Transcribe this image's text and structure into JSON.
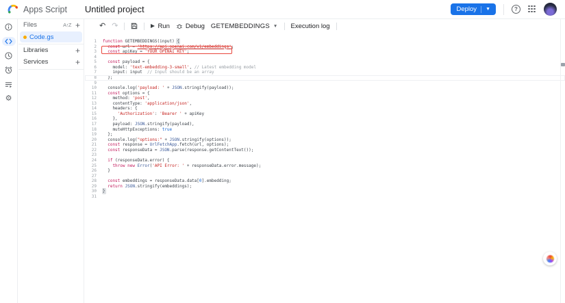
{
  "header": {
    "app_name": "Apps Script",
    "project_title": "Untitled project",
    "deploy_label": "Deploy",
    "icons": [
      "apps-script-logo",
      "help-icon",
      "apps-grid-icon",
      "user-avatar"
    ]
  },
  "colors": {
    "accent": "#1a73e8",
    "selected_file_bg": "#e8f0fe",
    "annotation_red": "#e8453c",
    "keyword": "#c2185b",
    "string": "#c5221f",
    "comment": "#9aa0a6",
    "builtin": "#3c5a99",
    "literal": "#1967d2",
    "file_dot": "#f9ab00"
  },
  "nav_rail": {
    "items": [
      {
        "name": "overview",
        "icon": "info-icon",
        "active": false
      },
      {
        "name": "editor",
        "icon": "code-icon",
        "active": true
      },
      {
        "name": "project-history",
        "icon": "clock-icon",
        "active": false
      },
      {
        "name": "triggers",
        "icon": "alarm-clock-icon",
        "active": false
      },
      {
        "name": "executions",
        "icon": "playlist-play-icon",
        "active": false
      },
      {
        "name": "project-settings",
        "icon": "gear-icon",
        "active": false
      }
    ]
  },
  "files_panel": {
    "title": "Files",
    "sort_icon": "sort-az-icon",
    "add_icon": "plus-icon",
    "files": [
      {
        "name": "Code.gs",
        "icon": "gs-file-dot-icon",
        "selected": true
      }
    ],
    "sections": [
      {
        "label": "Libraries"
      },
      {
        "label": "Services"
      }
    ]
  },
  "toolbar": {
    "undo_icon": "undo-icon",
    "redo_icon": "redo-icon",
    "save_icon": "save-icon",
    "run_label": "Run",
    "debug_label": "Debug",
    "function_selector": "GETEMBEDDINGS",
    "execution_log_label": "Execution log"
  },
  "editor": {
    "language": "javascript",
    "current_line": 8,
    "annotation": {
      "type": "red-highlight-box",
      "around_line": 3
    },
    "lines": [
      {
        "n": "1",
        "t": [
          [
            "kw",
            "function "
          ],
          [
            "id",
            "GETEMBEDDINGS(input) "
          ],
          [
            "brkt",
            "{"
          ]
        ]
      },
      {
        "n": "2",
        "t": [
          [
            "kw",
            "  const "
          ],
          [
            "id",
            "url = "
          ],
          [
            "strU",
            "'https://api.openai.com/v1/embeddings'"
          ],
          [
            "id",
            ";"
          ]
        ]
      },
      {
        "n": "3",
        "t": [
          [
            "kw",
            "  const "
          ],
          [
            "id",
            "apiKey = "
          ],
          [
            "str",
            "'YOUR_OPENAI_KEY'"
          ],
          [
            "id",
            ";"
          ]
        ]
      },
      {
        "n": "4",
        "t": []
      },
      {
        "n": "5",
        "t": [
          [
            "kw",
            "  const "
          ],
          [
            "id",
            "payload = {"
          ]
        ]
      },
      {
        "n": "6",
        "t": [
          [
            "id",
            "    model: "
          ],
          [
            "str",
            "'text-embedding-3-small'"
          ],
          [
            "id",
            ", "
          ],
          [
            "com",
            "// Latest embedding model"
          ]
        ]
      },
      {
        "n": "7",
        "t": [
          [
            "id",
            "    input: input  "
          ],
          [
            "com",
            "// Input should be an array"
          ]
        ]
      },
      {
        "n": "8",
        "t": [
          [
            "id",
            "  };"
          ]
        ]
      },
      {
        "n": "9",
        "t": []
      },
      {
        "n": "10",
        "t": [
          [
            "id",
            "  console.log("
          ],
          [
            "str",
            "'payload: '"
          ],
          [
            "id",
            " + "
          ],
          [
            "bi",
            "JSON"
          ],
          [
            "id",
            ".stringify(payload));"
          ]
        ]
      },
      {
        "n": "11",
        "t": [
          [
            "kw",
            "  const "
          ],
          [
            "id",
            "options = {"
          ]
        ]
      },
      {
        "n": "12",
        "t": [
          [
            "id",
            "    method: "
          ],
          [
            "str",
            "'post'"
          ],
          [
            "id",
            ","
          ]
        ]
      },
      {
        "n": "13",
        "t": [
          [
            "id",
            "    contentType: "
          ],
          [
            "str",
            "'application/json'"
          ],
          [
            "id",
            ","
          ]
        ]
      },
      {
        "n": "14",
        "t": [
          [
            "id",
            "    headers: {"
          ]
        ]
      },
      {
        "n": "15",
        "t": [
          [
            "id",
            "      "
          ],
          [
            "str",
            "'Authorization'"
          ],
          [
            "id",
            ": "
          ],
          [
            "str",
            "'Bearer '"
          ],
          [
            "id",
            " + apiKey"
          ]
        ]
      },
      {
        "n": "16",
        "t": [
          [
            "id",
            "    },"
          ]
        ]
      },
      {
        "n": "17",
        "t": [
          [
            "id",
            "    payload: "
          ],
          [
            "bi",
            "JSON"
          ],
          [
            "id",
            ".stringify(payload),"
          ]
        ]
      },
      {
        "n": "18",
        "t": [
          [
            "id",
            "    muteHttpExceptions: "
          ],
          [
            "lit",
            "true"
          ]
        ]
      },
      {
        "n": "19",
        "t": [
          [
            "id",
            "  };"
          ]
        ]
      },
      {
        "n": "20",
        "t": [
          [
            "id",
            "  console.log("
          ],
          [
            "str",
            "\"options:\""
          ],
          [
            "id",
            " + "
          ],
          [
            "bi",
            "JSON"
          ],
          [
            "id",
            ".stringify(options));"
          ]
        ]
      },
      {
        "n": "21",
        "t": [
          [
            "kw",
            "  const "
          ],
          [
            "id",
            "response = "
          ],
          [
            "bi",
            "UrlFetchApp"
          ],
          [
            "id",
            ".fetch(url, options);"
          ]
        ]
      },
      {
        "n": "22",
        "t": [
          [
            "kw",
            "  const "
          ],
          [
            "id",
            "responseData = "
          ],
          [
            "bi",
            "JSON"
          ],
          [
            "id",
            ".parse(response.getContentText());"
          ]
        ]
      },
      {
        "n": "23",
        "t": []
      },
      {
        "n": "24",
        "t": [
          [
            "kw",
            "  if "
          ],
          [
            "id",
            "(responseData.error) {"
          ]
        ]
      },
      {
        "n": "25",
        "t": [
          [
            "kw",
            "    throw new "
          ],
          [
            "bi",
            "Error"
          ],
          [
            "id",
            "("
          ],
          [
            "str",
            "'API Error: '"
          ],
          [
            "id",
            " + responseData.error.message);"
          ]
        ]
      },
      {
        "n": "26",
        "t": [
          [
            "id",
            "  }"
          ]
        ]
      },
      {
        "n": "27",
        "t": []
      },
      {
        "n": "28",
        "t": [
          [
            "kw",
            "  const "
          ],
          [
            "id",
            "embeddings = responseData.data["
          ],
          [
            "lit",
            "0"
          ],
          [
            "id",
            "].embedding;"
          ]
        ]
      },
      {
        "n": "29",
        "t": [
          [
            "kw",
            "  return "
          ],
          [
            "bi",
            "JSON"
          ],
          [
            "id",
            ".stringify(embeddings);"
          ]
        ]
      },
      {
        "n": "30",
        "t": [
          [
            "brkt",
            "}"
          ]
        ]
      },
      {
        "n": "31",
        "t": []
      }
    ]
  },
  "floating_button": {
    "icon": "extension-colorwheel-icon"
  }
}
